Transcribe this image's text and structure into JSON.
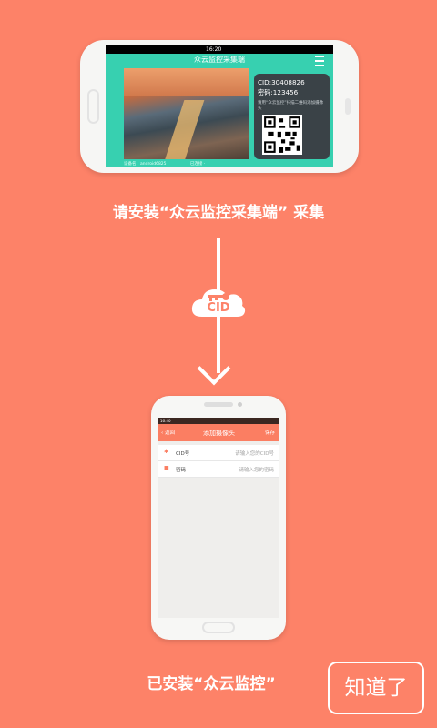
{
  "top_phone": {
    "status_time": "16:20",
    "app_title": "众云监控采集端",
    "cid_text": "CID:30408826",
    "password_text": "密码:123456",
    "qr_hint": "请用“众云监控”扫描二维码添加摄像头",
    "footer_device": "设备名：android6825",
    "footer_status": "· 已连接 ·"
  },
  "caption_install_collector": "请安装“众云监控采集端” 采集",
  "cloud_label": "CID",
  "bottom_phone": {
    "status_time": "16:40",
    "back_label": "返回",
    "title": "添加摄像头",
    "save_label": "保存",
    "rows": [
      {
        "label": "CID号",
        "placeholder": "请输入您的CID号"
      },
      {
        "label": "密码",
        "placeholder": "请输入您的密码"
      }
    ]
  },
  "caption_installed": "已安装“众云监控”",
  "ok_button": "知道了"
}
